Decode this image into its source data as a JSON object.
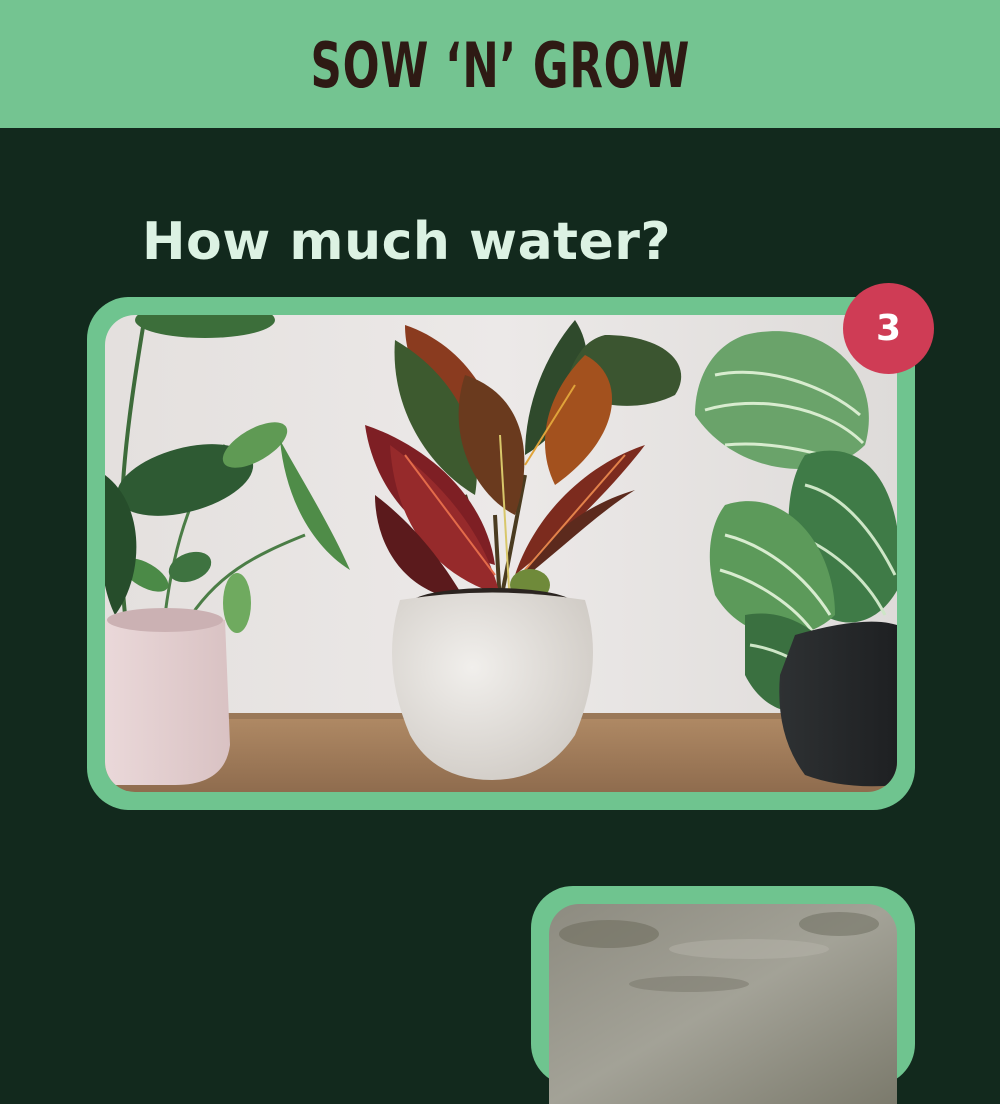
{
  "header": {
    "brand_title": "SOW ‘N’ GROW",
    "background_color": "#74c491",
    "text_color": "#2e1a14"
  },
  "question": {
    "text": "How much water?",
    "color": "#dcf2e3"
  },
  "option_cards": [
    {
      "image_name": "houseplants-in-pots-photo",
      "badge": "3",
      "border_color": "#6fc48f",
      "badge_color": "#cf3c55"
    },
    {
      "image_name": "textured-stone-photo",
      "border_color": "#6fc48f"
    }
  ],
  "page_background": "#12291d"
}
